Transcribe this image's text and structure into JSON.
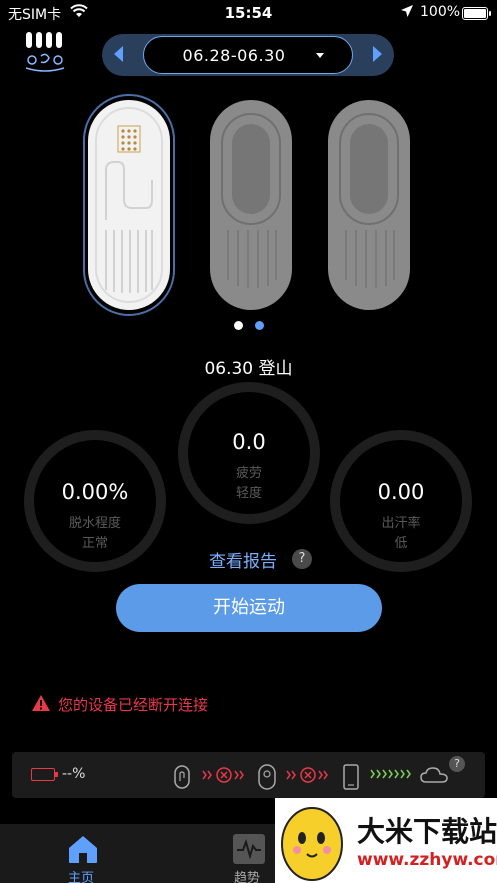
{
  "status_bar": {
    "carrier": "无SIM卡",
    "time": "15:54",
    "battery": "100%"
  },
  "date_picker": {
    "range": "06.28-06.30"
  },
  "session": {
    "title": "06.30  登山"
  },
  "gauges": {
    "fatigue": {
      "value": "0.0",
      "label1": "疲劳",
      "label2": "轻度"
    },
    "dehydration": {
      "value": "0.00%",
      "label1": "脱水程度",
      "label2": "正常"
    },
    "sweat_rate": {
      "value": "0.00",
      "label1": "出汗率",
      "label2": "低"
    }
  },
  "report": {
    "link": "查看报告",
    "help": "?"
  },
  "start_button": "开始运动",
  "warning": "您的设备已经断开连接",
  "device_bar": {
    "battery": "--%",
    "help": "?"
  },
  "tabs": {
    "home": "主页",
    "trend": "趋势"
  },
  "watermark": {
    "brand": "大米下载站",
    "url": "www.zzhyw.com"
  },
  "colors": {
    "accent": "#5b9be8",
    "link": "#7ab0ff",
    "warning": "#e8384a",
    "tab_active": "#5fa0ff"
  }
}
